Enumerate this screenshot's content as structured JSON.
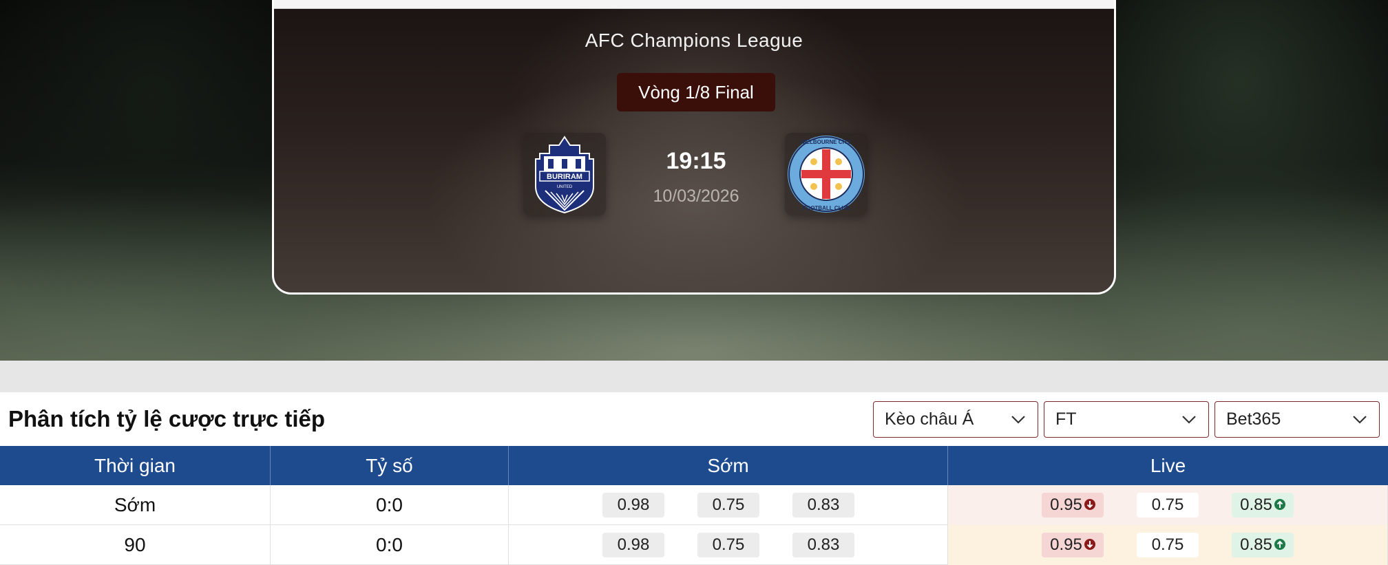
{
  "match": {
    "league": "AFC Champions League",
    "round": "Vòng 1/8 Final",
    "time": "19:15",
    "date": "10/03/2026",
    "home_logo_text": "BURIRAM",
    "home_logo_subtext": "UNITED",
    "away_logo_text": "MELBOURNE CITY",
    "away_logo_subtext": "FOOTBALL CLUB"
  },
  "odds_section": {
    "title": "Phân tích tỷ lệ cược trực tiếp",
    "selects": {
      "market": "Kèo châu Á",
      "period": "FT",
      "bookmaker": "Bet365"
    }
  },
  "table": {
    "headers": [
      "Thời gian",
      "Tỷ số",
      "Sớm",
      "Live"
    ],
    "rows": [
      {
        "time": "Sớm",
        "score": "0:0",
        "early": [
          "0.98",
          "0.75",
          "0.83"
        ],
        "live": [
          "0.95",
          "0.75",
          "0.85"
        ]
      },
      {
        "time": "90",
        "score": "0:0",
        "early": [
          "0.98",
          "0.75",
          "0.83"
        ],
        "live": [
          "0.95",
          "0.75",
          "0.85"
        ]
      }
    ]
  },
  "colors": {
    "header_blue": "#1e4a8e",
    "round_badge": "#3a0f0a",
    "odds_down": "#8b1a1a",
    "odds_up": "#1f7a4a"
  },
  "icons": [
    "chevron-down-icon",
    "odds-down-icon",
    "odds-up-icon"
  ]
}
